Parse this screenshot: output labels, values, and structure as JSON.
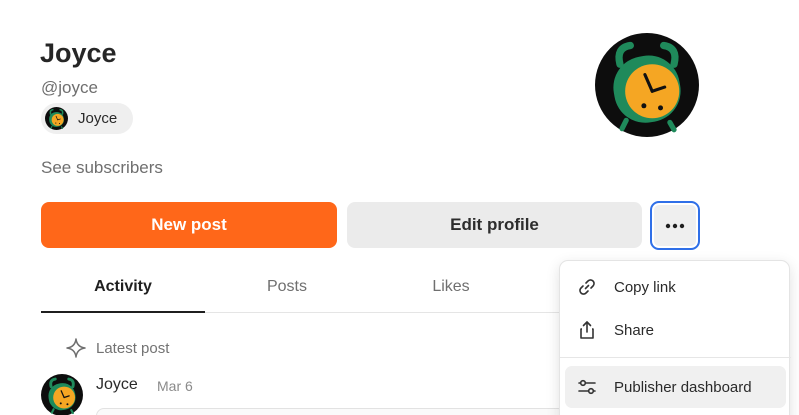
{
  "profile": {
    "name": "Joyce",
    "handle": "@joyce",
    "publication_chip": "Joyce",
    "see_subscribers": "See subscribers"
  },
  "actions": {
    "new_post": "New post",
    "edit_profile": "Edit profile",
    "more_icon": "ellipsis-icon"
  },
  "tabs": [
    {
      "label": "Activity",
      "active": true
    },
    {
      "label": "Posts",
      "active": false
    },
    {
      "label": "Likes",
      "active": false
    }
  ],
  "activity": {
    "section_label": "Latest post",
    "post": {
      "author": "Joyce",
      "date": "Mar 6"
    }
  },
  "menu": {
    "items": [
      {
        "label": "Copy link",
        "icon": "link-icon"
      },
      {
        "label": "Share",
        "icon": "share-icon"
      },
      {
        "label": "Publisher dashboard",
        "icon": "sliders-icon",
        "highlighted": true
      }
    ]
  },
  "colors": {
    "primary": "#ff6719",
    "focus_ring": "#2f6fe8",
    "avatar_green": "#1f8a5b",
    "avatar_orange": "#f5a623"
  }
}
